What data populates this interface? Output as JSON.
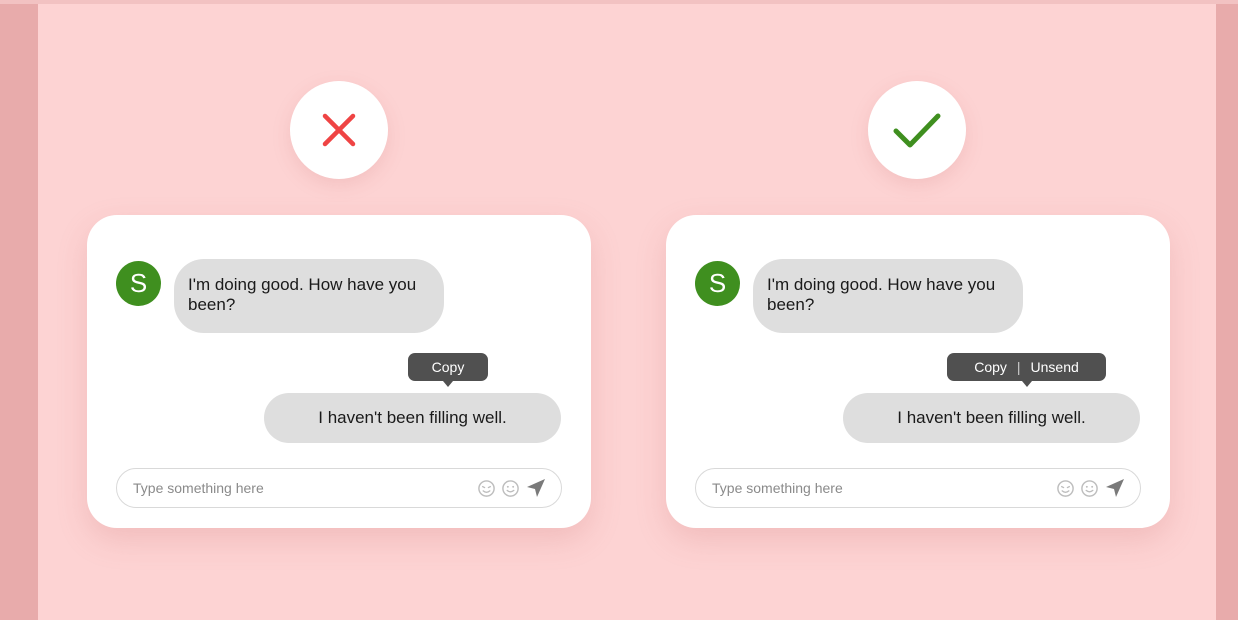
{
  "colors": {
    "background": "#fdd3d3",
    "edge": "#e8abab",
    "cross": "#ef4444",
    "check": "#3f8f1f",
    "avatar": "#3f8f1f",
    "bubble": "#dedede",
    "menu": "#505050"
  },
  "examples": [
    {
      "verdict_icon": "cross-icon",
      "avatar_letter": "S",
      "received_message": "I'm doing good. How have you been?",
      "sent_message": "I haven't been filling well.",
      "context_menu": [
        "Copy"
      ],
      "input_placeholder": "Type something here",
      "input_icons": [
        "sticker-icon",
        "emoji-icon",
        "send-icon"
      ]
    },
    {
      "verdict_icon": "check-icon",
      "avatar_letter": "S",
      "received_message": "I'm doing good. How have you been?",
      "sent_message": "I haven't been filling well.",
      "context_menu": [
        "Copy",
        "Unsend"
      ],
      "input_placeholder": "Type something here",
      "input_icons": [
        "sticker-icon",
        "emoji-icon",
        "send-icon"
      ]
    }
  ]
}
